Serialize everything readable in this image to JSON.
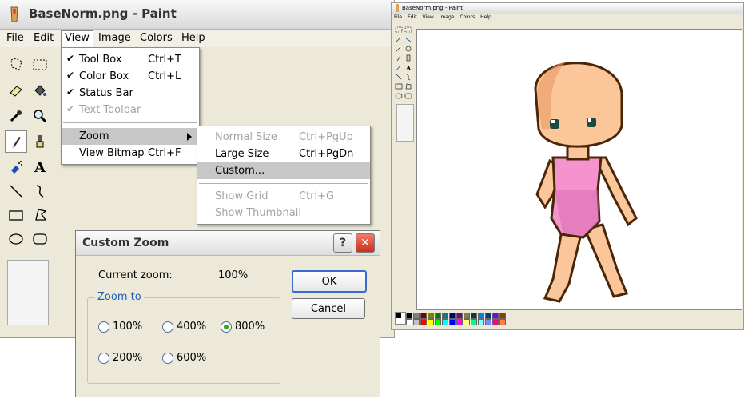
{
  "main_window": {
    "title": "BaseNorm.png - Paint",
    "menus": [
      "File",
      "Edit",
      "View",
      "Image",
      "Colors",
      "Help"
    ]
  },
  "view_menu": {
    "items": [
      {
        "label": "Tool Box",
        "shortcut": "Ctrl+T",
        "checked": "✔"
      },
      {
        "label": "Color Box",
        "shortcut": "Ctrl+L",
        "checked": "✔"
      },
      {
        "label": "Status Bar",
        "shortcut": "",
        "checked": "✔"
      },
      {
        "label": "Text Toolbar",
        "shortcut": "",
        "checked": "✔"
      },
      {
        "label": "Zoom",
        "shortcut": "",
        "checked": ""
      },
      {
        "label": "View Bitmap",
        "shortcut": "Ctrl+F",
        "checked": ""
      }
    ]
  },
  "zoom_menu": {
    "items": [
      {
        "label": "Normal Size",
        "shortcut": "Ctrl+PgUp"
      },
      {
        "label": "Large Size",
        "shortcut": "Ctrl+PgDn"
      },
      {
        "label": "Custom...",
        "shortcut": ""
      },
      {
        "label": "Show Grid",
        "shortcut": "Ctrl+G"
      },
      {
        "label": "Show Thumbnail",
        "shortcut": ""
      }
    ]
  },
  "dialog": {
    "title": "Custom Zoom",
    "help_label": "?",
    "close_label": "✕",
    "current_zoom_label": "Current zoom:",
    "current_zoom_value": "100%",
    "zoom_to_label": "Zoom to",
    "options": [
      "100%",
      "400%",
      "800%",
      "200%",
      "600%"
    ],
    "selected": "800%",
    "ok_label": "OK",
    "cancel_label": "Cancel"
  },
  "preview_window": {
    "title": "BaseNorm.png - Paint",
    "menus": [
      "File",
      "Edit",
      "View",
      "Image",
      "Colors",
      "Help"
    ]
  },
  "colors": {
    "skin": "#fbc79a",
    "skin_shadow": "#e89a63",
    "outline": "#4a2608",
    "swimsuit": "#f593cf",
    "swimsuit_shadow": "#d264a8",
    "eye": "#1d4a3d"
  }
}
